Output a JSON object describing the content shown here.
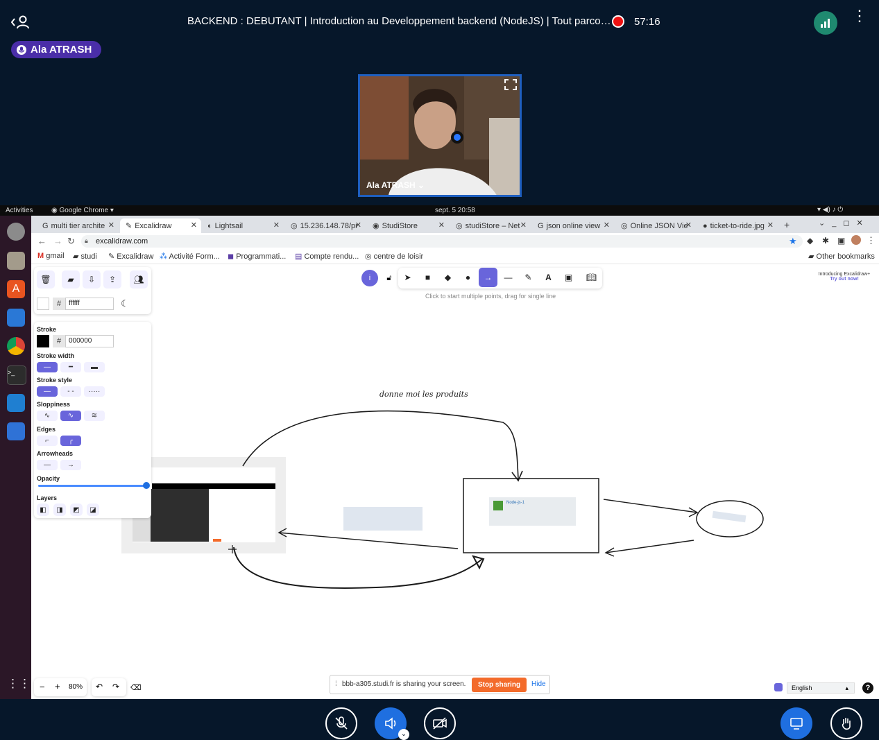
{
  "meeting": {
    "title": "BACKEND : DEBUTANT | Introduction au Developpement backend (NodeJS) | Tout parco…",
    "record_time": "57:16",
    "speaker_pill": "Ala ATRASH",
    "video_name": "Ala ATRASH"
  },
  "system": {
    "activities": "Activities",
    "app": "Google Chrome",
    "datetime": "sept. 5  20:58"
  },
  "browser": {
    "tabs": [
      {
        "label": "multi tier archite"
      },
      {
        "label": "Excalidraw"
      },
      {
        "label": "Lightsail"
      },
      {
        "label": "15.236.148.78/pr"
      },
      {
        "label": "StudiStore"
      },
      {
        "label": "studiStore – Net"
      },
      {
        "label": "json online view"
      },
      {
        "label": "Online JSON Vie"
      },
      {
        "label": "ticket-to-ride.jpg"
      }
    ],
    "url": "excalidraw.com",
    "bookmarks": [
      {
        "label": "gmail"
      },
      {
        "label": "studi"
      },
      {
        "label": "Excalidraw"
      },
      {
        "label": "Activité Form..."
      },
      {
        "label": "Programmati..."
      },
      {
        "label": "Compte rendu..."
      },
      {
        "label": "centre de loisir"
      }
    ],
    "other_bookmarks": "Other bookmarks"
  },
  "excalidraw": {
    "bg_hash": "#",
    "bg_value": "ffffff",
    "stroke_label": "Stroke",
    "stroke_hash": "#",
    "stroke_value": "000000",
    "stroke_width_label": "Stroke width",
    "stroke_style_label": "Stroke style",
    "sloppiness_label": "Sloppiness",
    "edges_label": "Edges",
    "arrowheads_label": "Arrowheads",
    "opacity_label": "Opacity",
    "opacity_value": 1.0,
    "layers_label": "Layers",
    "hint": "Click to start multiple points, drag for single line",
    "promo_title": "Introducing Excalidraw+",
    "promo_link": "Try out now!",
    "drawing_text": "donne moi les produits",
    "node_card_title": "Node-js-1",
    "zoom": "80%",
    "language": "English",
    "accent": "#6965db"
  },
  "screenshare": {
    "message": "bbb-a305.studi.fr is sharing your screen.",
    "stop_label": "Stop sharing",
    "hide_label": "Hide"
  },
  "colors": {
    "app_bg": "#06172a",
    "presenter_blue": "#1f5fbf",
    "pill": "#4a2ea8",
    "stop_orange": "#f36b2b"
  }
}
